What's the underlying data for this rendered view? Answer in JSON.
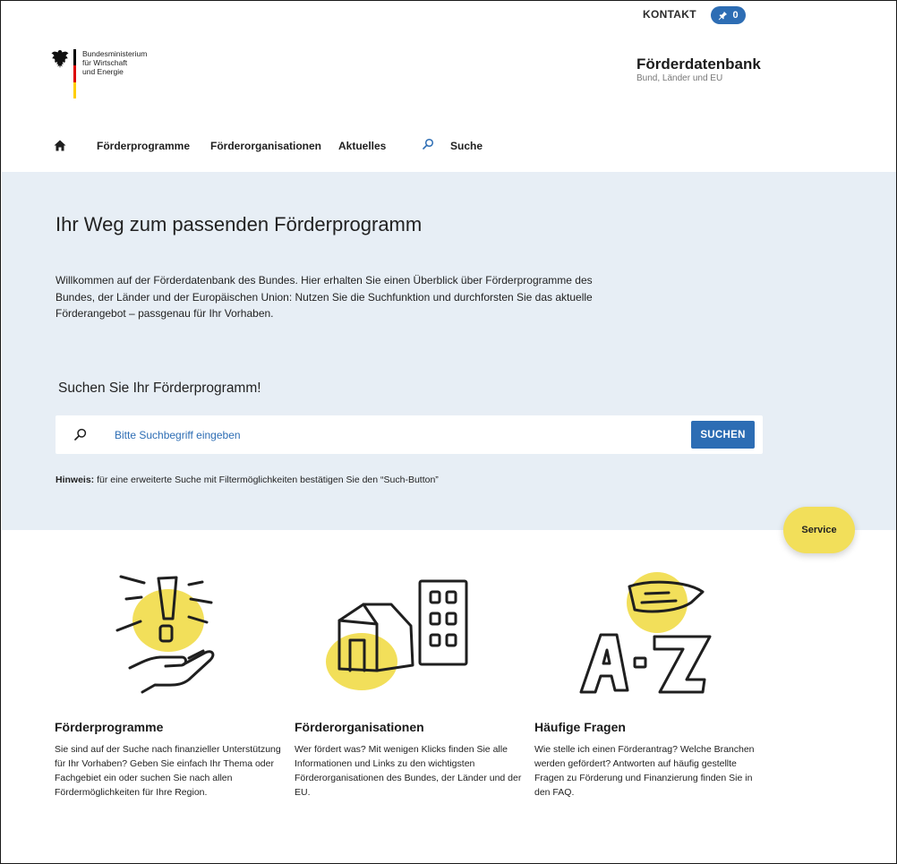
{
  "topbar": {
    "kontakt_label": "KONTAKT",
    "pin_count": "0"
  },
  "logo": {
    "lines": [
      "Bundesministerium",
      "für Wirtschaft",
      "und Energie"
    ],
    "flag_colors": [
      "#000000",
      "#dd0000",
      "#ffce00"
    ]
  },
  "site": {
    "title": "Förderdatenbank",
    "subtitle": "Bund, Länder und EU"
  },
  "nav": {
    "items": [
      "Förderprogramme",
      "Förderorganisationen",
      "Aktuelles"
    ],
    "search_label": "Suche"
  },
  "hero": {
    "title": "Ihr Weg zum passenden Förderprogramm",
    "intro": "Willkommen auf der Förderdatenbank des Bundes. Hier erhalten Sie einen Überblick über Förderprogramme des Bundes, der Länder und der Europäischen Union: Nutzen Sie die Suchfunktion und durchforsten Sie das aktuelle Förderangebot – passgenau für Ihr Vorhaben.",
    "search_heading": "Suchen Sie Ihr Förderprogramm!",
    "search_placeholder": "Bitte Suchbegriff eingeben",
    "search_button": "SUCHEN",
    "hint_label": "Hinweis:",
    "hint_text": " für eine erweiterte Suche mit Filtermöglichkeiten bestätigen Sie den “Such-Button”"
  },
  "service_label": "Service",
  "cards": [
    {
      "icon": "hand-exclamation-icon",
      "title": "Förderprogramme",
      "text": "Sie sind auf der Suche nach finanzieller Unterstützung für Ihr Vorhaben? Geben Sie einfach Ihr Thema oder Fachgebiet ein oder suchen Sie nach allen Fördermöglichkeiten für Ihre Region."
    },
    {
      "icon": "buildings-icon",
      "title": "Förderorganisationen",
      "text": "Wer fördert was? Mit wenigen Klicks finden Sie alle Informationen und Links zu den wichtigsten Förderorganisationen des Bundes, der Länder und der EU."
    },
    {
      "icon": "a-z-speech-bubble-icon",
      "title": "Häufige Fragen",
      "text": "Wie stelle ich einen Förderantrag? Welche Branchen werden gefördert? Antworten auf häufig gestellte Fragen zu Förderung und Finanzierung finden Sie in den FAQ."
    }
  ],
  "colors": {
    "accent_blue": "#2d6db4",
    "hero_bg": "#e7eef5",
    "highlight_yellow": "#f2df5a"
  }
}
